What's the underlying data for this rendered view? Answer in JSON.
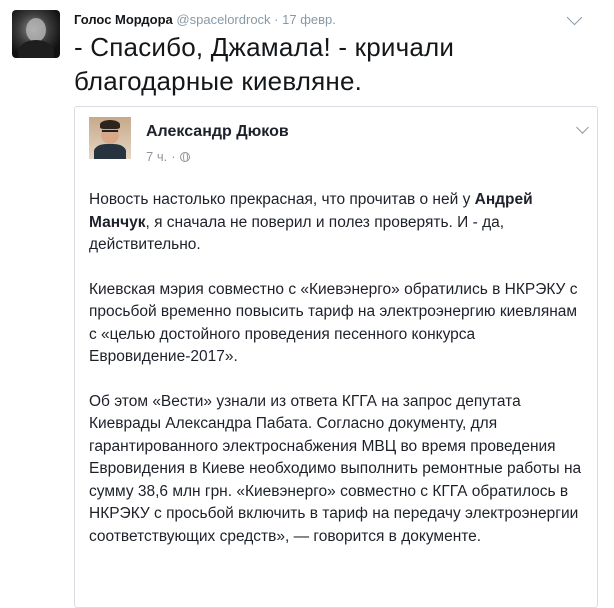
{
  "tweet": {
    "author_name": "Голос Мордора",
    "handle": "@spacelordrock",
    "separator": "·",
    "date": "17 февр.",
    "text": "- Спасибо, Джамала! - кричали благодарные киевляне.",
    "avatar_icon": "user-avatar-icon",
    "menu_icon": "chevron-down-icon"
  },
  "embedded_post": {
    "author_name": "Александр Дюков",
    "time": "7 ч.",
    "separator": "·",
    "privacy_icon": "globe-icon",
    "menu_icon": "chevron-down-icon",
    "paragraph_1_pre": "Новость настолько прекрасная, что прочитав о ней у ",
    "paragraph_1_bold": "Андрей Манчук",
    "paragraph_1_post": ", я сначала не поверил и полез проверять. И - да, действительно.",
    "paragraph_2": "Киевская мэрия совместно с «Киевэнерго» обратились в НКРЭКУ с просьбой временно повысить тариф на электроэнергию киевлянам с «целью достойного проведения песенного конкурса Евровидение-2017».",
    "paragraph_3": "Об этом «Вести» узнали из ответа КГГА на запрос депутата Киеврады Александра Пабата. Согласно документу, для гарантированного электроснабжения МВЦ во время проведения Евровидения в Киеве необходимо выполнить ремонтные работы на сумму 38,6 млн грн. «Киевэнерго» совместно с КГГА обратилось в НКРЭКУ с просьбой включить в тариф на передачу электроэнергии соответствующих средств», — говорится в документе."
  }
}
